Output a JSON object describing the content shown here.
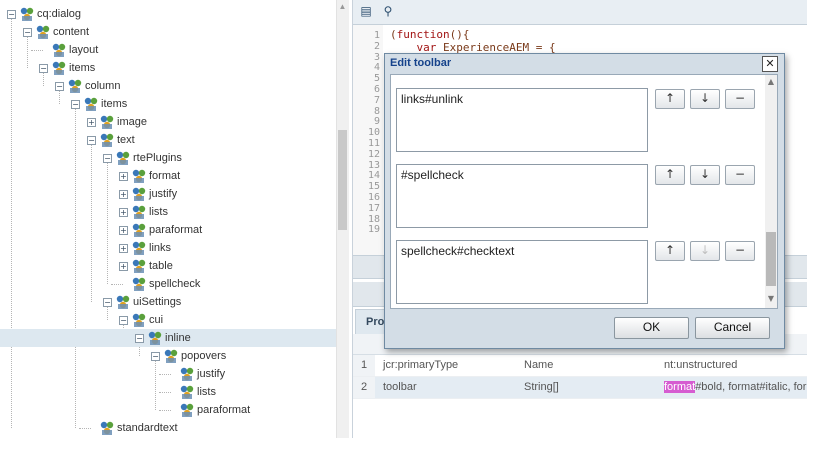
{
  "tree": {
    "nodes": [
      {
        "label": "cq:dialog"
      },
      {
        "label": "content"
      },
      {
        "label": "layout"
      },
      {
        "label": "items"
      },
      {
        "label": "column"
      },
      {
        "label": "items"
      },
      {
        "label": "image"
      },
      {
        "label": "text"
      },
      {
        "label": "rtePlugins"
      },
      {
        "label": "format"
      },
      {
        "label": "justify"
      },
      {
        "label": "lists"
      },
      {
        "label": "paraformat"
      },
      {
        "label": "links"
      },
      {
        "label": "table"
      },
      {
        "label": "spellcheck"
      },
      {
        "label": "uiSettings"
      },
      {
        "label": "cui"
      },
      {
        "label": "inline"
      },
      {
        "label": "popovers"
      },
      {
        "label": "justify"
      },
      {
        "label": "lists"
      },
      {
        "label": "paraformat"
      },
      {
        "label": "standardtext"
      }
    ],
    "selected": "inline"
  },
  "editor": {
    "line_numbers": [
      "1",
      "2",
      "3",
      "4",
      "5",
      "6",
      "7",
      "8",
      "9",
      "10",
      "11",
      "12",
      "13",
      "14",
      "15",
      "16",
      "17",
      "18",
      "19"
    ],
    "code_line1_paren": "(",
    "code_line1_kw": "function",
    "code_line1_rest": "(){",
    "code_line2_kw": "var",
    "code_line2_rest": " ExperienceAEM = {"
  },
  "properties": {
    "tab_label": "Pro",
    "rows": [
      {
        "num": "1",
        "name": "jcr:primaryType",
        "type": "Name",
        "value": "nt:unstructured"
      },
      {
        "num": "2",
        "name": "toolbar",
        "type": "String[]",
        "value_highlight": "format",
        "value_rest": "#bold, format#italic, for"
      }
    ]
  },
  "dialog": {
    "title": "Edit toolbar",
    "close_glyph": "✕",
    "entries": [
      {
        "value": "links#unlink"
      },
      {
        "value": "#spellcheck"
      },
      {
        "value": "spellcheck#checktext"
      }
    ],
    "move_up_glyph": "↑",
    "move_down_glyph": "↓",
    "remove_glyph": "−",
    "ok_label": "OK",
    "cancel_label": "Cancel"
  },
  "colors": {
    "dialog_title": "#15428b",
    "highlight": "#d65cd1",
    "selected_row": "#dde8f0"
  }
}
